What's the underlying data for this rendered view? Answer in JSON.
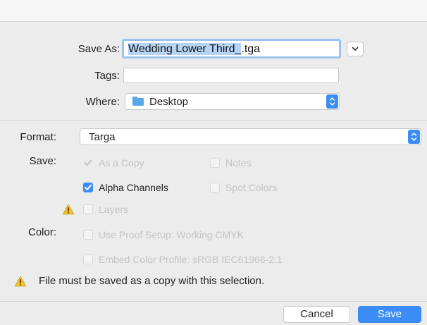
{
  "dialog": {
    "save_as_label": "Save As:",
    "save_as_value_selected": "Wedding Lower Third_",
    "save_as_value_ext": ".tga",
    "tags_label": "Tags:",
    "tags_value": "",
    "where_label": "Where:",
    "where_value": "Desktop",
    "format_label": "Format:",
    "format_value": "Targa",
    "save_label": "Save:",
    "color_label": "Color:"
  },
  "options": {
    "as_a_copy": {
      "label": "As a Copy",
      "checked": true,
      "enabled": false
    },
    "notes": {
      "label": "Notes",
      "checked": false,
      "enabled": false
    },
    "alpha_channels": {
      "label": "Alpha Channels",
      "checked": true,
      "enabled": true
    },
    "spot_colors": {
      "label": "Spot Colors",
      "checked": false,
      "enabled": false
    },
    "layers": {
      "label": "Layers",
      "checked": false,
      "enabled": false
    },
    "use_proof_setup": {
      "label": "Use Proof Setup:  Working CMYK",
      "checked": false,
      "enabled": false
    },
    "embed_color_profile": {
      "label": "Embed Color Profile:  sRGB IEC61966-2.1",
      "checked": false,
      "enabled": false
    }
  },
  "warning": {
    "message": "File must be saved as a copy with this selection."
  },
  "buttons": {
    "cancel": "Cancel",
    "save": "Save"
  },
  "colors": {
    "accent": "#3b8cf4",
    "warning": "#f2c12e",
    "folder": "#58a7e8"
  },
  "icons": {
    "expand": "chevron-down-icon",
    "warning": "warning-triangle-icon",
    "folder": "folder-icon",
    "stepper": "up-down-stepper-icon",
    "checkmark": "checkmark-icon"
  }
}
